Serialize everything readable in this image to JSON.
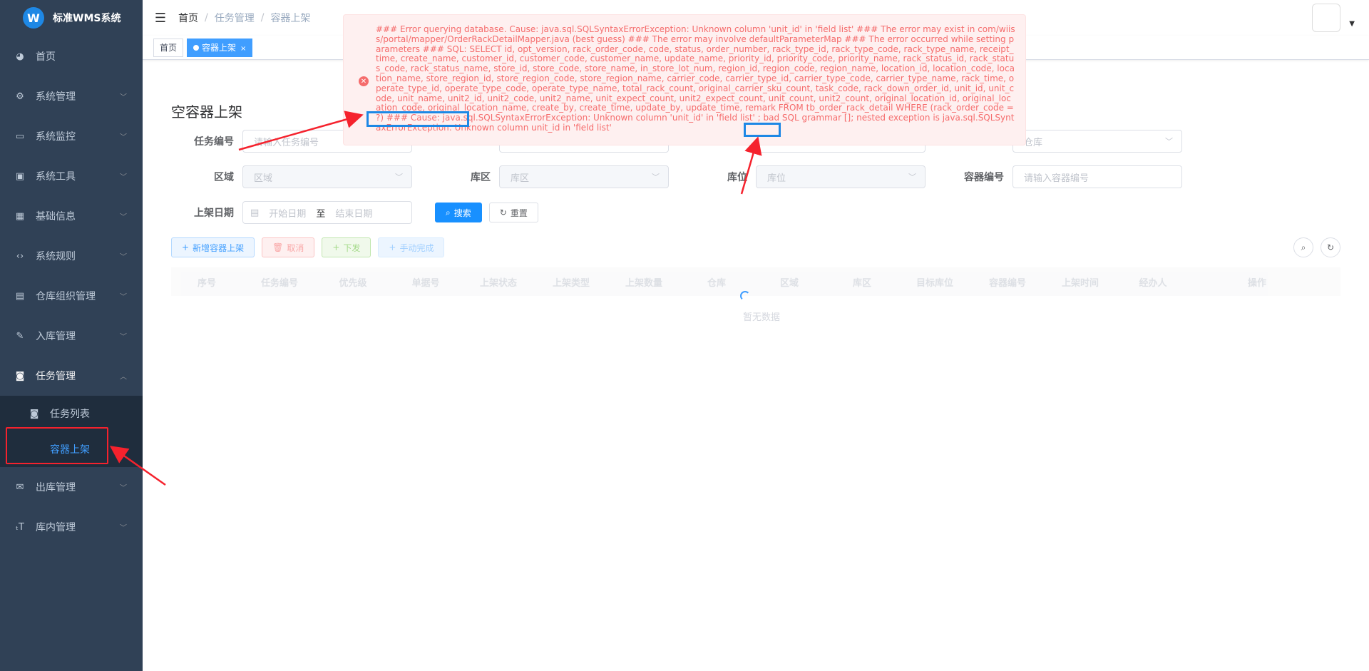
{
  "app": {
    "title": "标准WMS系统",
    "logo_letter": "W"
  },
  "sidebar": {
    "items": [
      {
        "label": "首页",
        "icon": "dashboard-icon",
        "glyph": "◕"
      },
      {
        "label": "系统管理",
        "icon": "gear-icon",
        "glyph": "⚙"
      },
      {
        "label": "系统监控",
        "icon": "monitor-icon",
        "glyph": "▭"
      },
      {
        "label": "系统工具",
        "icon": "toolbox-icon",
        "glyph": "▣"
      },
      {
        "label": "基础信息",
        "icon": "grid-icon",
        "glyph": "▦"
      },
      {
        "label": "系统规则",
        "icon": "code-icon",
        "glyph": "‹›"
      },
      {
        "label": "仓库组织管理",
        "icon": "table-icon",
        "glyph": "▤"
      },
      {
        "label": "入库管理",
        "icon": "edit-icon",
        "glyph": "✎"
      },
      {
        "label": "任务管理",
        "icon": "task-icon",
        "glyph": "◙"
      },
      {
        "label": "出库管理",
        "icon": "outbox-icon",
        "glyph": "✉"
      },
      {
        "label": "库内管理",
        "icon": "text-icon",
        "glyph": "ₜT"
      }
    ],
    "sub_items": [
      {
        "label": "任务列表",
        "glyph": "◙"
      },
      {
        "label": "容器上架"
      }
    ]
  },
  "navbar": {
    "breadcrumb": [
      "首页",
      "任务管理",
      "容器上架"
    ]
  },
  "tags": {
    "home": "首页",
    "active": "容器上架",
    "close": "×"
  },
  "page": {
    "title": "空容器上架",
    "fields": {
      "task_no": {
        "label": "任务编号",
        "placeholder": "请输入任务编号"
      },
      "warehouse": {
        "placeholder": "仓库"
      },
      "region": {
        "label": "区域",
        "placeholder": "区域"
      },
      "zone": {
        "label": "库区",
        "placeholder": "库区"
      },
      "location": {
        "label": "库位",
        "placeholder": "库位"
      },
      "container_no": {
        "label": "容器编号",
        "placeholder": "请输入容器编号"
      },
      "date": {
        "label": "上架日期",
        "start": "开始日期",
        "to": "至",
        "end": "结束日期"
      }
    },
    "buttons": {
      "search": "搜索",
      "reset": "重置",
      "add": "新增容器上架",
      "cancel": "取消",
      "dispatch": "下发",
      "manual_complete": "手动完成"
    },
    "table": {
      "columns": [
        "序号",
        "任务编号",
        "优先级",
        "单据号",
        "上架状态",
        "上架类型",
        "上架数量",
        "仓库",
        "区域",
        "库区",
        "目标库位",
        "容器编号",
        "上架时间",
        "经办人",
        "操作"
      ],
      "empty": "暂无数据"
    }
  },
  "error": {
    "before_table": "### Error querying database. Cause: java.sql.SQLSyntaxErrorException: Unknown column 'unit_id' in 'field list' ### The error may exist in com/wiiss/portal/mapper/OrderRackDetailMapper.java (best guess) ### The error may involve defaultParameterMap ### The error occurred while setting parameters ### SQL: SELECT id, opt_version, rack_order_code, code, status, order_number, rack_type_id, rack_type_code, rack_type_name, receipt_time, create_name, customer_id, customer_code, customer_name, update_name, priority_id, priority_code, priority_name, rack_status_id, rack_status_code, rack_status_name, store_id, store_code, store_name, in_store_lot_num, region_id, region_code, region_name, location_id, location_code, location_name, store_region_id, store_region_code, store_region_name, carrier_code, carrier_type_id, carrier_type_code, carrier_type_name, rack_time, operate_type_id, operate_type_code, operate_type_name, total_rack_count, original_carrier_sku_count, task_code, rack_down_order_id, unit_id, unit_code, unit_name, unit2_id, unit2_code, unit2_name, unit_expect_count, unit2_expect_count, unit_count, unit2_count, original_location_id, original_location_code, original_location_name, create_by, create_time, update_by, update_time, remark FROM ",
    "table_name": "tb_order_rack_detail",
    "middle": " WHERE (rack_order_code = ?) ### Cause: java.sql.SQLSyntaxErrorException: Unknown column 'unit_id' in 'field list' ; bad SQL grammar []; nested exception is java.sql.SQLSyntaxErrorException: Unknown column ",
    "column": "unit_id",
    "after": " in 'field list'"
  },
  "colors": {
    "sidebar_bg": "#304156",
    "submenu_bg": "#1f2d3d",
    "accent": "#409eff",
    "error": "#f56c6c",
    "annotation_red": "#f5222d",
    "annotation_blue": "#1e88e5"
  }
}
